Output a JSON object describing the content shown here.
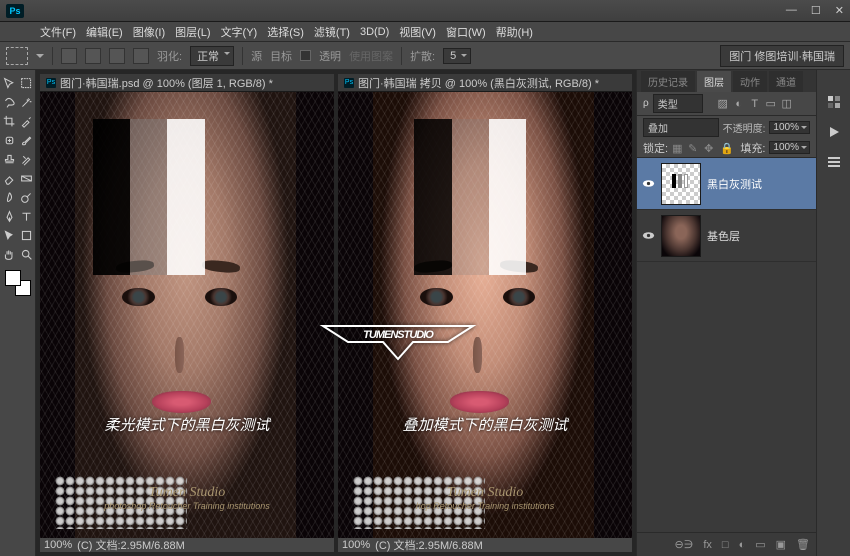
{
  "menu": {
    "file": "文件(F)",
    "edit": "编辑(E)",
    "image": "图像(I)",
    "layer": "图层(L)",
    "type": "文字(Y)",
    "select": "选择(S)",
    "filter": "滤镜(T)",
    "d3": "3D(D)",
    "view": "视图(V)",
    "window": "窗口(W)",
    "help": "帮助(H)"
  },
  "options": {
    "feather_lbl": "羽化:",
    "mode": "正常",
    "src": "源",
    "dest": "目标",
    "trans": "透明",
    "use_pattern": "使用图案",
    "zoom_lbl": "扩散:",
    "zoom_val": "5",
    "right_label": "图门 修图培训·韩国瑞"
  },
  "docs": [
    {
      "title": "图门·韩国瑞.psd @ 100% (图层 1, RGB/8) *",
      "caption": "柔光模式下的黑白灰测试",
      "footer": "(C) 文档:2.95M/6.88M",
      "zoom": "100%",
      "studio1": "Tumen Studio",
      "studio2": "photoshop Retoucher Training institutions"
    },
    {
      "title": "图门·韩国瑞 拷贝 @ 100% (黑白灰测试, RGB/8) *",
      "caption": "叠加模式下的黑白灰测试",
      "footer": "(C) 文档:2.95M/6.88M",
      "zoom": "100%",
      "studio1": "Tumen Studio",
      "studio2": "hop Retoucher Training institutions"
    }
  ],
  "logo": "TUMENSTUDIO",
  "panel": {
    "tabs": {
      "history": "历史记录",
      "layers": "图层",
      "actions": "动作",
      "channels": "通道"
    },
    "filter_kind": "类型",
    "blend": "叠加",
    "opacity_lbl": "不透明度:",
    "opacity": "100%",
    "lock_lbl": "锁定:",
    "fill_lbl": "填充:",
    "fill": "100%",
    "layers": [
      {
        "name": "黑白灰测试"
      },
      {
        "name": "基色层"
      }
    ],
    "foot": {
      "link": "⊖∋",
      "fx": "fx",
      "mask": "□",
      "adj": "◐",
      "group": "▭",
      "new": "▣",
      "del": "🗑"
    }
  }
}
